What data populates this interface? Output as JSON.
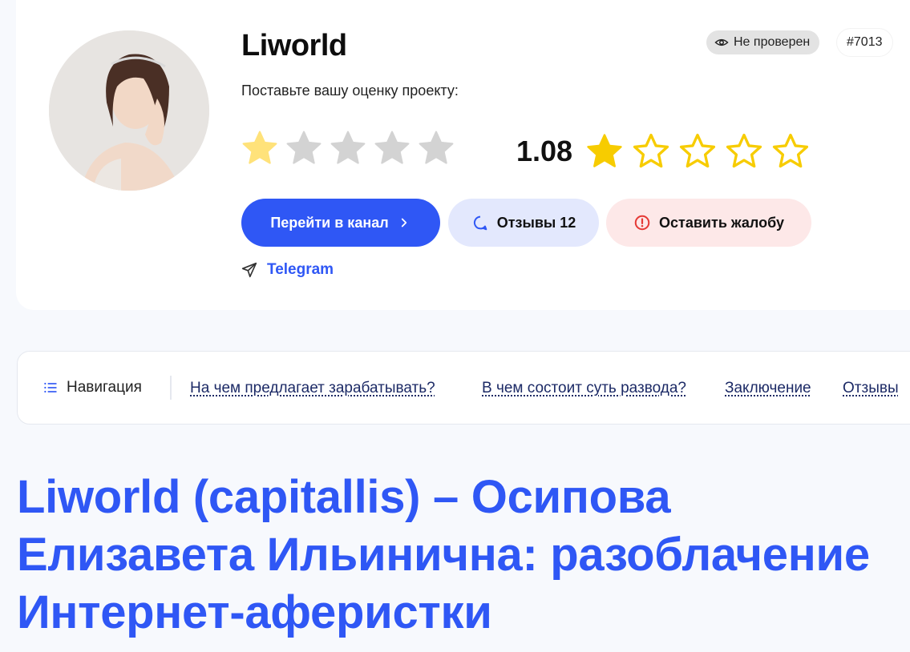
{
  "project": {
    "title": "Liworld",
    "rate_prompt": "Поставьте вашу оценку проекту:",
    "user_rating_stars": 1,
    "score": "1.08",
    "score_stars_filled": 1,
    "total_stars": 5,
    "status": "Не проверен",
    "id": "#7013",
    "platform": "Telegram"
  },
  "buttons": {
    "go_channel": "Перейти в канал",
    "reviews": "Отзывы 12",
    "complaint": "Оставить жалобу"
  },
  "nav": {
    "heading": "Навигация",
    "links": [
      "На чем предлагает зарабатывать?",
      "В чем состоит суть развода?",
      "Заключение",
      "Отзывы"
    ]
  },
  "headline": "Liworld (capitallis) – Осипова Елизавета Ильинична: разоблачение Интернет-аферистки",
  "colors": {
    "accent": "#2f57f5",
    "star_filled": "#f7cc00",
    "star_user": "#ffe27a",
    "star_empty": "#d3d3d3",
    "complaint_icon": "#e53935"
  },
  "icons": {
    "status": "eye-icon",
    "primary_button": "chevron-right-icon",
    "reviews": "chat-bubble-icon",
    "complaint": "alert-circle-icon",
    "platform": "paper-plane-icon",
    "nav": "list-icon"
  }
}
